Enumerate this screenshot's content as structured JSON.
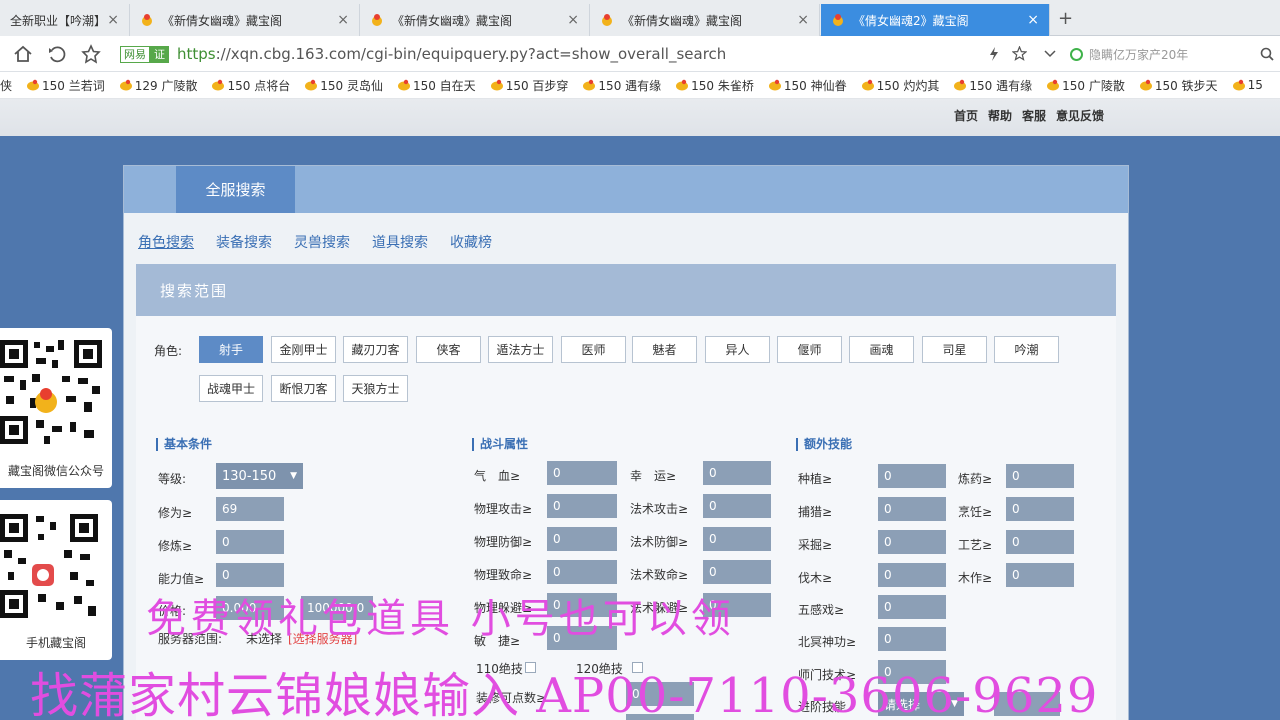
{
  "tabs": [
    {
      "label": "全新职业【吟潮】上",
      "active": false
    },
    {
      "label": "《新倩女幽魂》藏宝阁",
      "active": false
    },
    {
      "label": "《新倩女幽魂》藏宝阁",
      "active": false
    },
    {
      "label": "《新倩女幽魂》藏宝阁",
      "active": false
    },
    {
      "label": "《倩女幽魂2》藏宝阁",
      "active": true
    }
  ],
  "tab_close": "×",
  "newtab": "+",
  "address": {
    "badge1": "网易",
    "badge2": "证",
    "url_secure": "https",
    "url_rest": "://xqn.cbg.163.com/cgi-bin/equipquery.py?act=show_overall_search",
    "search_text": "隐瞒亿万家产20年"
  },
  "bookmarks": [
    "侠",
    "150 兰若词",
    "129 广陵散",
    "150 点将台",
    "150 灵岛仙",
    "150 自在天",
    "150 百步穿",
    "150 遇有缘",
    "150 朱雀桥",
    "150 神仙眷",
    "150 灼灼其",
    "150 遇有缘",
    "150 广陵散",
    "150 铁步天",
    "15"
  ],
  "toplinks": [
    "首页",
    "帮助",
    "客服",
    "意见反馈"
  ],
  "panel": {
    "title": "全服搜索",
    "subtabs": [
      "角色搜索",
      "装备搜索",
      "灵兽搜索",
      "道具搜索",
      "收藏榜"
    ],
    "range_title": "搜索范围"
  },
  "roles": {
    "label": "角色:",
    "items": [
      "射手",
      "金刚甲士",
      "藏刃刀客",
      "侠客",
      "遁法方士",
      "医师",
      "魅者",
      "异人",
      "偃师",
      "画魂",
      "司星",
      "吟潮",
      "战魂甲士",
      "断恨刀客",
      "天狼方士"
    ]
  },
  "basic": {
    "title": "基本条件",
    "level_label": "等级:",
    "level_value": "130-150",
    "xiuwei_label": "修为≥",
    "xiuwei_value": "69",
    "xiulian_label": "修炼≥",
    "xiulian_value": "0",
    "nengli_label": "能力值≥",
    "nengli_value": "0",
    "price_label": "价格:",
    "price_min": "0.000",
    "price_max": "100000.0",
    "server_label": "服务器范围:",
    "server_value": "未选择",
    "server_link": "[选择服务器]"
  },
  "battle": {
    "title": "战斗属性",
    "left": [
      {
        "label": "气　血≥",
        "value": "0"
      },
      {
        "label": "物理攻击≥",
        "value": "0"
      },
      {
        "label": "物理防御≥",
        "value": "0"
      },
      {
        "label": "物理致命≥",
        "value": "0"
      },
      {
        "label": "物理躲避≥",
        "value": "0"
      },
      {
        "label": "敏　捷≥",
        "value": "0"
      }
    ],
    "right": [
      {
        "label": "幸　运≥",
        "value": "0"
      },
      {
        "label": "法术攻击≥",
        "value": "0"
      },
      {
        "label": "法术防御≥",
        "value": "0"
      },
      {
        "label": "法术致命≥",
        "value": "0"
      },
      {
        "label": "法术躲避≥",
        "value": "0"
      }
    ],
    "check1": "110绝技",
    "check2": "120绝技",
    "skillpoint_label": "装修可点数≥",
    "skillpoint_value": "0"
  },
  "extra": {
    "title": "额外技能",
    "left": [
      {
        "label": "种植≥",
        "value": "0"
      },
      {
        "label": "捕猎≥",
        "value": "0"
      },
      {
        "label": "采掘≥",
        "value": "0"
      },
      {
        "label": "伐木≥",
        "value": "0"
      },
      {
        "label": "五感戏≥",
        "value": "0"
      },
      {
        "label": "北冥神功≥",
        "value": "0"
      },
      {
        "label": "师门技术≥",
        "value": "0"
      }
    ],
    "right": [
      {
        "label": "炼药≥",
        "value": "0"
      },
      {
        "label": "烹饪≥",
        "value": "0"
      },
      {
        "label": "工艺≥",
        "value": "0"
      },
      {
        "label": "木作≥",
        "value": "0"
      }
    ],
    "advanced_label": "进阶技能",
    "advanced_value": "请选择"
  },
  "qr": {
    "label1": "藏宝阁微信公众号",
    "label2": "手机藏宝阁"
  },
  "overlay": {
    "line1": "免费领礼包道具 小号也可以领",
    "line2": "找蒲家村云锦娘娘输入 AP00-7110-3606-9629"
  },
  "colors": {
    "accent": "#5d8bc6",
    "page_bg": "#4f77ad",
    "overlay": "#e14de0"
  }
}
